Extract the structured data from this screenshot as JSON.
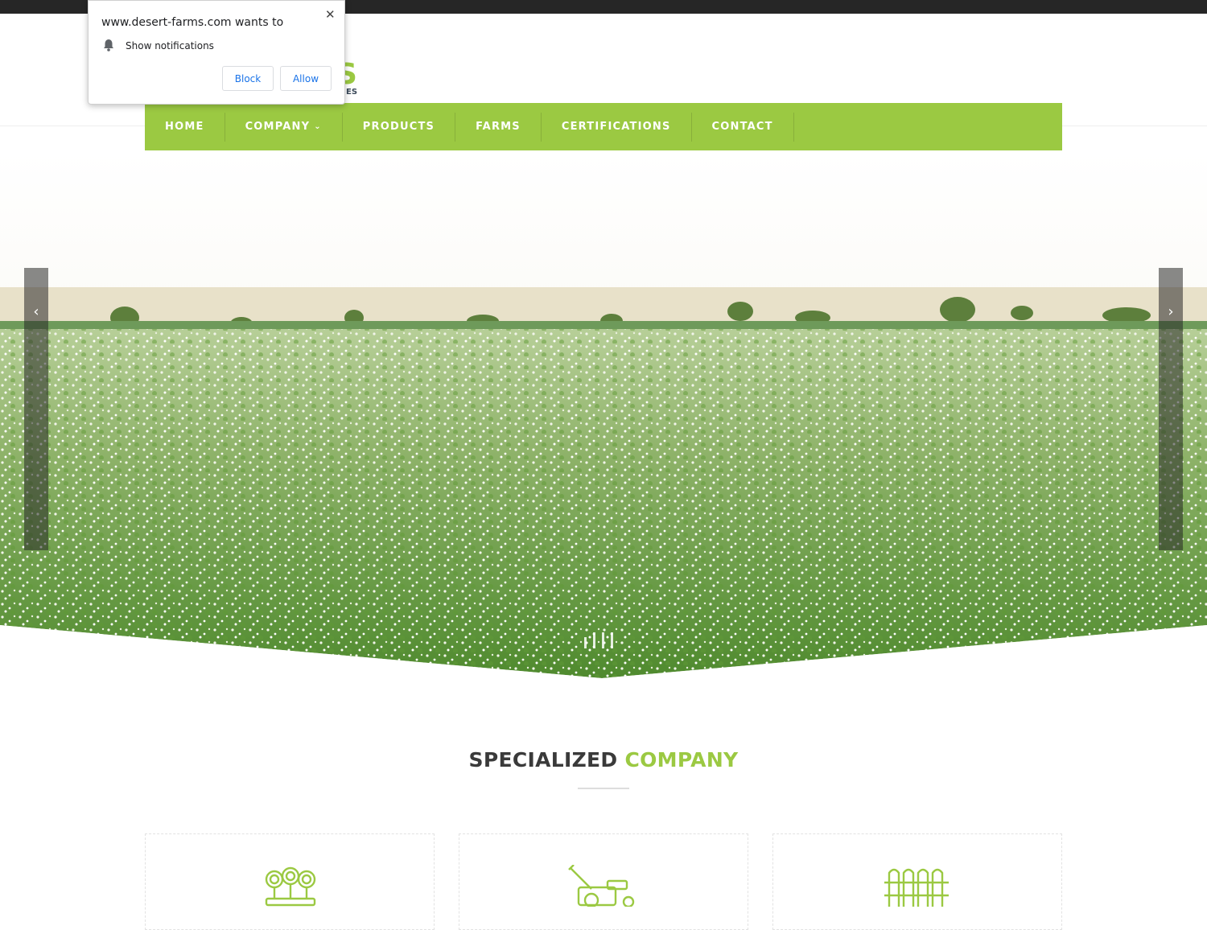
{
  "browser_prompt": {
    "origin_text": "www.desert-farms.com wants to",
    "permission_text": "Show notifications",
    "block_label": "Block",
    "allow_label": "Allow",
    "close_symbol": "✕",
    "bell_icon": "bell-icon"
  },
  "logo": {
    "visible_fragment": "S",
    "visible_fragment_2": "ES",
    "brand_color": "#9bc942"
  },
  "nav": {
    "items": [
      {
        "label": "HOME"
      },
      {
        "label": "COMPANY",
        "has_dropdown": true,
        "dropdown_icon": "chevron-down-icon"
      },
      {
        "label": "PRODUCTS"
      },
      {
        "label": "FARMS"
      },
      {
        "label": "CERTIFICATIONS"
      },
      {
        "label": "CONTACT"
      }
    ],
    "background": "#9bc942"
  },
  "slider": {
    "prev_symbol": "‹",
    "next_symbol": "›",
    "dot_count": 4,
    "active_dot": 1
  },
  "section": {
    "title_part1": "SPECIALIZED",
    "title_part2": "COMPANY",
    "accent_color": "#9bc942"
  },
  "cards": [
    {
      "icon": "flower-bed-icon"
    },
    {
      "icon": "lawn-mower-icon"
    },
    {
      "icon": "fence-icon"
    }
  ]
}
